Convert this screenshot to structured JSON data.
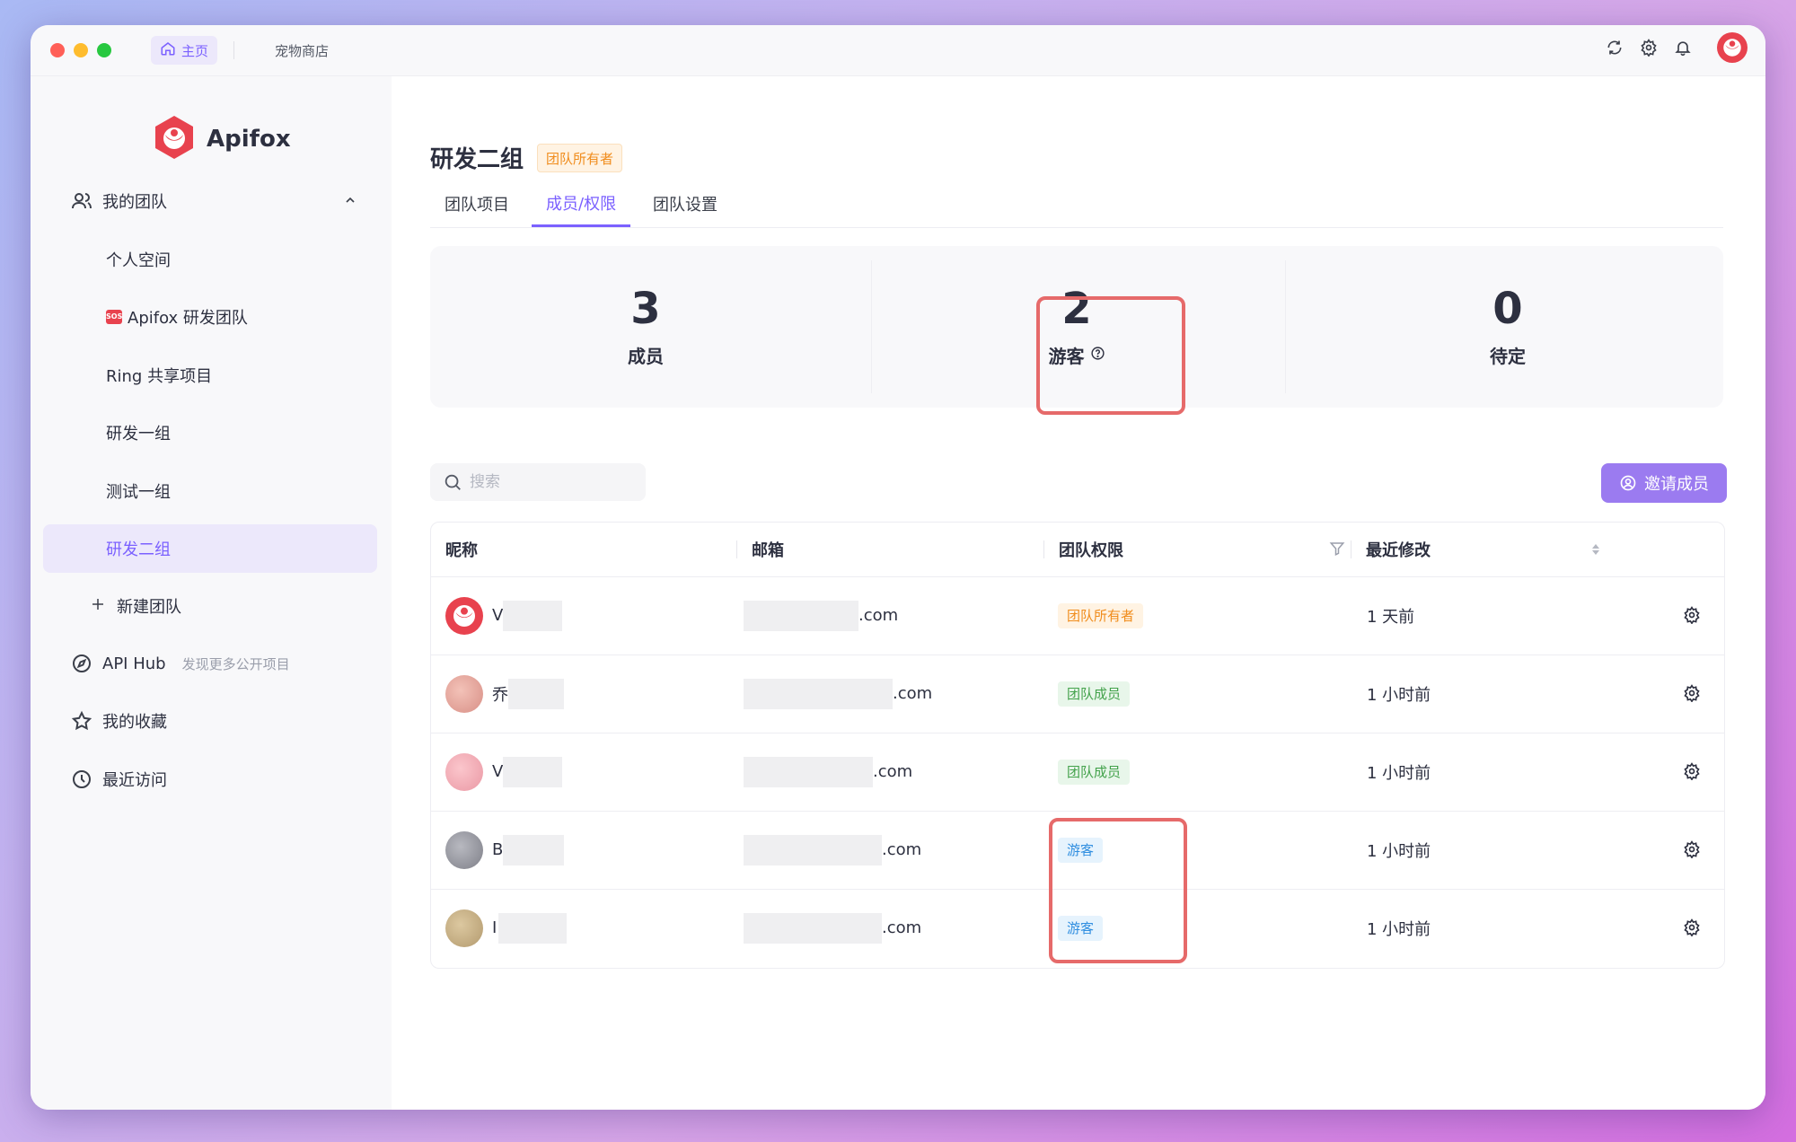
{
  "titlebar": {
    "home_tab": "主页",
    "shop_tab": "宠物商店"
  },
  "sidebar": {
    "logo_text": "Apifox",
    "my_teams": "我的团队",
    "teams": [
      {
        "label": "个人空间"
      },
      {
        "label": "Apifox 研发团队",
        "badge": "SOS"
      },
      {
        "label": "Ring 共享项目"
      },
      {
        "label": "研发一组"
      },
      {
        "label": "测试一组"
      },
      {
        "label": "研发二组"
      }
    ],
    "new_team": "新建团队",
    "api_hub": "API Hub",
    "api_hub_hint": "发现更多公开项目",
    "favorites": "我的收藏",
    "recent": "最近访问"
  },
  "main": {
    "title": "研发二组",
    "role_badge": "团队所有者",
    "tabs": [
      {
        "label": "团队项目"
      },
      {
        "label": "成员/权限"
      },
      {
        "label": "团队设置"
      }
    ],
    "stats": [
      {
        "value": "3",
        "label": "成员"
      },
      {
        "value": "2",
        "label": "游客"
      },
      {
        "value": "0",
        "label": "待定"
      }
    ],
    "search_placeholder": "搜索",
    "invite_label": "邀请成员",
    "table": {
      "headers": [
        "昵称",
        "邮箱",
        "团队权限",
        "最近修改"
      ],
      "rows": [
        {
          "nick_initial": "V",
          "email_suffix": ".com",
          "role": "团队所有者",
          "modified": "1 天前"
        },
        {
          "nick_initial": "乔",
          "email_suffix": ".com",
          "role": "团队成员",
          "modified": "1 小时前"
        },
        {
          "nick_initial": "V",
          "email_suffix": ".com",
          "role": "团队成员",
          "modified": "1 小时前"
        },
        {
          "nick_initial": "B",
          "email_suffix": ".com",
          "role": "游客",
          "modified": "1 小时前"
        },
        {
          "nick_initial": "I",
          "email_suffix": ".com",
          "role": "游客",
          "modified": "1 小时前"
        }
      ]
    }
  },
  "colors": {
    "accent": "#7b61ff",
    "highlight_box": "#e66a6a",
    "owner_badge": "#f08c1c",
    "member_badge": "#43a24b",
    "guest_badge": "#2f8ee0"
  }
}
